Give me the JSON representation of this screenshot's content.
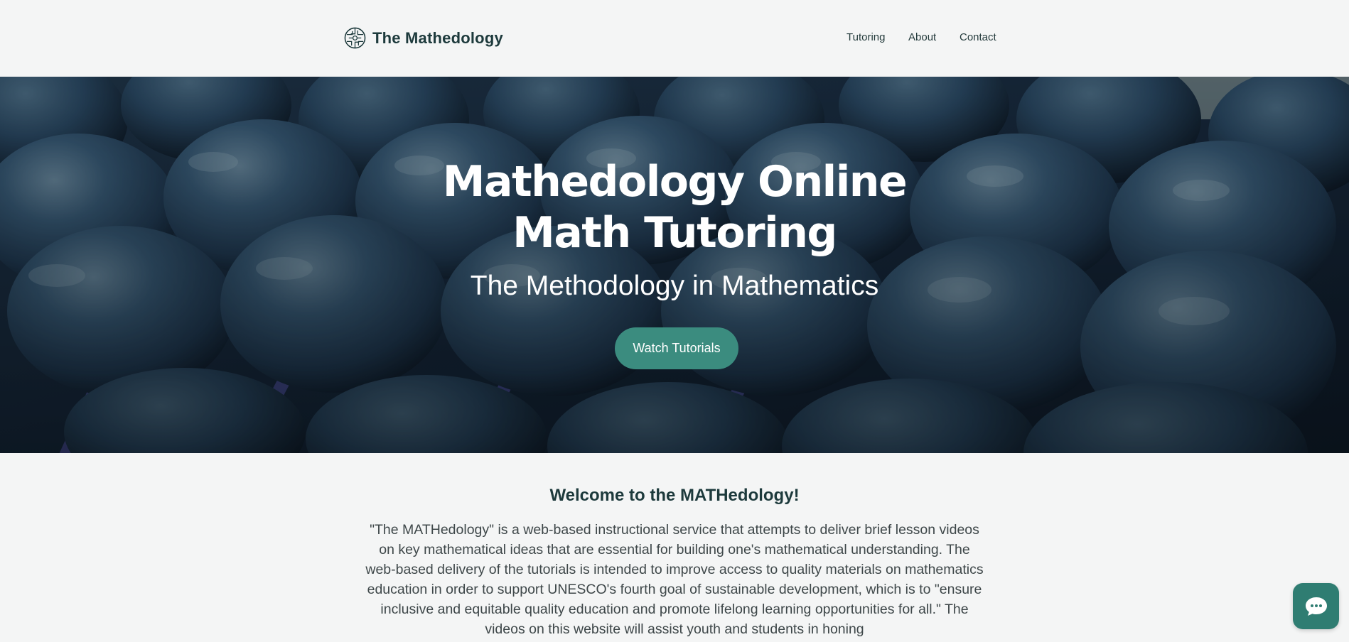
{
  "header": {
    "brand_name": "The Mathedology",
    "logo_icon": "globe-logo-icon",
    "nav": [
      {
        "label": "Tutoring"
      },
      {
        "label": "About"
      },
      {
        "label": "Contact"
      }
    ]
  },
  "hero": {
    "title_line1": "Mathedology Online",
    "title_line2": "Math Tutoring",
    "subtitle": "The Methodology in Mathematics",
    "cta_label": "Watch Tutorials",
    "background": "abacus-beads-photo"
  },
  "welcome": {
    "heading": "Welcome to the MATHedology!",
    "body": "\"The MATHedology\" is a web-based instructional service that attempts to deliver brief lesson videos on key mathematical ideas that are essential for building one's mathematical understanding. The web-based delivery of the tutorials is intended to improve access to quality materials on mathematics education in order to support UNESCO's fourth goal of sustainable development, which is to \"ensure inclusive and equitable quality education and promote lifelong learning opportunities for all.\" The videos on this website will assist youth and students in honing"
  },
  "chat": {
    "icon": "chat-bubble-icon"
  },
  "colors": {
    "accent": "#3b8c7f",
    "heading": "#1d3a3c",
    "page_bg": "#f4f5f5",
    "chat_bg": "#2f7d72"
  }
}
